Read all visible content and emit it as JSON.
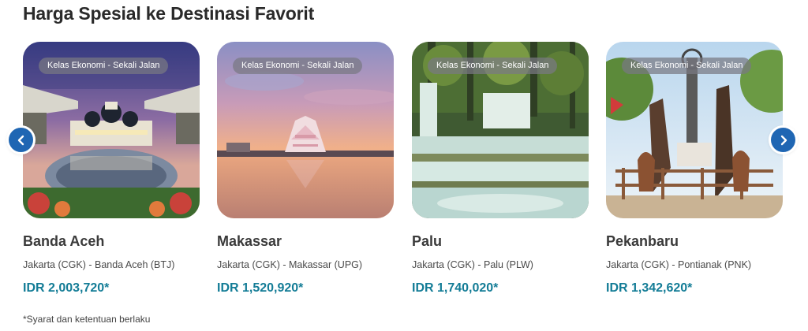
{
  "section": {
    "title": "Harga Spesial ke Destinasi Favorit"
  },
  "cards": [
    {
      "badge": "Kelas Ekonomi - Sekali Jalan",
      "city": "Banda Aceh",
      "route": "Jakarta (CGK) - Banda Aceh (BTJ)",
      "price": "IDR 2,003,720*"
    },
    {
      "badge": "Kelas Ekonomi - Sekali Jalan",
      "city": "Makassar",
      "route": "Jakarta (CGK) - Makassar (UPG)",
      "price": "IDR 1,520,920*"
    },
    {
      "badge": "Kelas Ekonomi - Sekali Jalan",
      "city": "Palu",
      "route": "Jakarta (CGK) - Palu (PLW)",
      "price": "IDR 1,740,020*"
    },
    {
      "badge": "Kelas Ekonomi - Sekali Jalan",
      "city": "Pekanbaru",
      "route": "Jakarta (CGK) - Pontianak (PNK)",
      "price": "IDR 1,342,620*"
    }
  ],
  "navigation": {
    "prev_icon": "chevron-left-icon",
    "next_icon": "chevron-right-icon",
    "button_color": "#1f66b3"
  },
  "footnote": "*Syarat dan ketentuan berlaku",
  "colors": {
    "price": "#137c96",
    "title": "#2a2a2a"
  }
}
